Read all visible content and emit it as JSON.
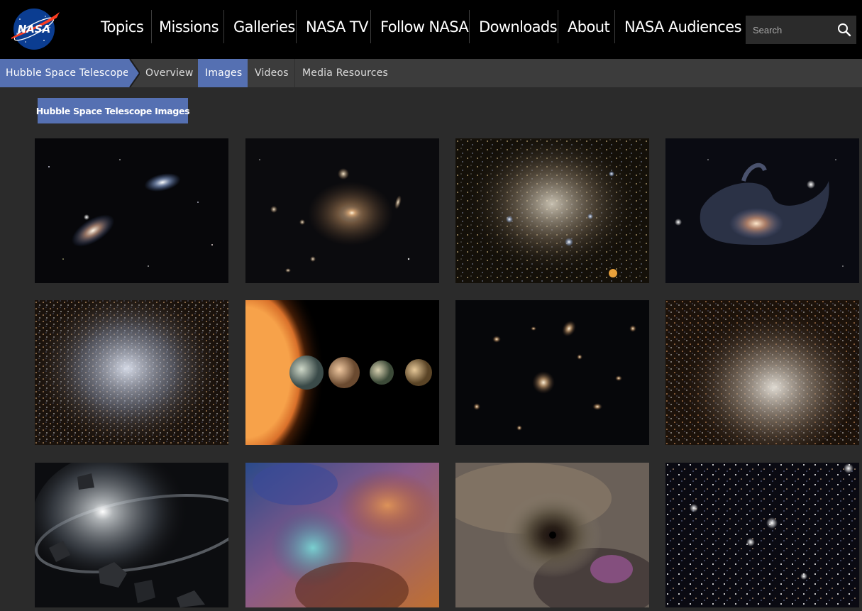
{
  "header": {
    "logo_text": "NASA",
    "nav": [
      "Topics",
      "Missions",
      "Galleries",
      "NASA TV",
      "Follow NASA",
      "Downloads",
      "About",
      "NASA Audiences"
    ],
    "search": {
      "placeholder": "Search",
      "icon": "search-icon"
    }
  },
  "subnav": {
    "section_title": "Hubble Space Telescope",
    "tabs": [
      "Overview",
      "Images",
      "Videos",
      "Media Resources"
    ],
    "active_tab": "Images"
  },
  "gallery": {
    "title": "Hubble Space Telescope Images",
    "columns": 4,
    "rows": 3
  },
  "colors": {
    "accent": "#5570b2",
    "nav_background": "#000000",
    "subnav_background": "#3c3c3c",
    "page_background": "#2b2b2b"
  }
}
